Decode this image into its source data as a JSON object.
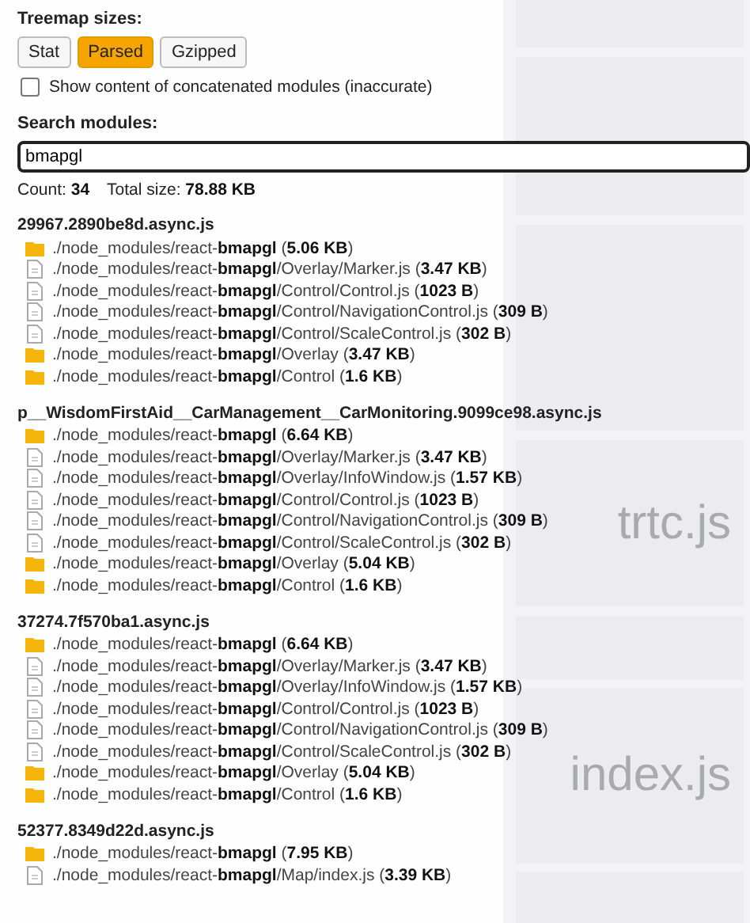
{
  "treemap_sizes": {
    "label": "Treemap sizes:",
    "options": [
      {
        "label": "Stat",
        "selected": false
      },
      {
        "label": "Parsed",
        "selected": true
      },
      {
        "label": "Gzipped",
        "selected": false
      }
    ]
  },
  "concatenated": {
    "label": "Show content of concatenated modules (inaccurate)",
    "checked": false
  },
  "search": {
    "label": "Search modules:",
    "value": "bmapgl"
  },
  "summary": {
    "count": "Count: **34**",
    "total": "Total size: **78.88 KB**"
  },
  "groups": [
    {
      "name": "29967.2890be8d.async.js",
      "modules": [
        {
          "kind": "folder",
          "text": "./node_modules/react-**bmapgl** (**5.06 KB**)"
        },
        {
          "kind": "file",
          "text": "./node_modules/react-**bmapgl**/Overlay/Marker.js (**3.47 KB**)"
        },
        {
          "kind": "file",
          "text": "./node_modules/react-**bmapgl**/Control/Control.js (**1023 B**)"
        },
        {
          "kind": "file",
          "text": "./node_modules/react-**bmapgl**/Control/NavigationControl.js (**309 B**)"
        },
        {
          "kind": "file",
          "text": "./node_modules/react-**bmapgl**/Control/ScaleControl.js (**302 B**)"
        },
        {
          "kind": "folder",
          "text": "./node_modules/react-**bmapgl**/Overlay (**3.47 KB**)"
        },
        {
          "kind": "folder",
          "text": "./node_modules/react-**bmapgl**/Control (**1.6 KB**)"
        }
      ]
    },
    {
      "name": "p__WisdomFirstAid__CarManagement__CarMonitoring.9099ce98.async.js",
      "modules": [
        {
          "kind": "folder",
          "text": "./node_modules/react-**bmapgl** (**6.64 KB**)"
        },
        {
          "kind": "file",
          "text": "./node_modules/react-**bmapgl**/Overlay/Marker.js (**3.47 KB**)"
        },
        {
          "kind": "file",
          "text": "./node_modules/react-**bmapgl**/Overlay/InfoWindow.js (**1.57 KB**)"
        },
        {
          "kind": "file",
          "text": "./node_modules/react-**bmapgl**/Control/Control.js (**1023 B**)"
        },
        {
          "kind": "file",
          "text": "./node_modules/react-**bmapgl**/Control/NavigationControl.js (**309 B**)"
        },
        {
          "kind": "file",
          "text": "./node_modules/react-**bmapgl**/Control/ScaleControl.js (**302 B**)"
        },
        {
          "kind": "folder",
          "text": "./node_modules/react-**bmapgl**/Overlay (**5.04 KB**)"
        },
        {
          "kind": "folder",
          "text": "./node_modules/react-**bmapgl**/Control (**1.6 KB**)"
        }
      ]
    },
    {
      "name": "37274.7f570ba1.async.js",
      "modules": [
        {
          "kind": "folder",
          "text": "./node_modules/react-**bmapgl** (**6.64 KB**)"
        },
        {
          "kind": "file",
          "text": "./node_modules/react-**bmapgl**/Overlay/Marker.js (**3.47 KB**)"
        },
        {
          "kind": "file",
          "text": "./node_modules/react-**bmapgl**/Overlay/InfoWindow.js (**1.57 KB**)"
        },
        {
          "kind": "file",
          "text": "./node_modules/react-**bmapgl**/Control/Control.js (**1023 B**)"
        },
        {
          "kind": "file",
          "text": "./node_modules/react-**bmapgl**/Control/NavigationControl.js (**309 B**)"
        },
        {
          "kind": "file",
          "text": "./node_modules/react-**bmapgl**/Control/ScaleControl.js (**302 B**)"
        },
        {
          "kind": "folder",
          "text": "./node_modules/react-**bmapgl**/Overlay (**5.04 KB**)"
        },
        {
          "kind": "folder",
          "text": "./node_modules/react-**bmapgl**/Control (**1.6 KB**)"
        }
      ]
    },
    {
      "name": "52377.8349d22d.async.js",
      "modules": [
        {
          "kind": "folder",
          "text": "./node_modules/react-**bmapgl** (**7.95 KB**)"
        },
        {
          "kind": "file",
          "text": "./node_modules/react-**bmapgl**/Map/index.js (**3.39 KB**)"
        }
      ]
    }
  ],
  "treemap": {
    "tiles": [
      {
        "label": "trtc.js"
      },
      {
        "label": "index.js"
      }
    ]
  }
}
